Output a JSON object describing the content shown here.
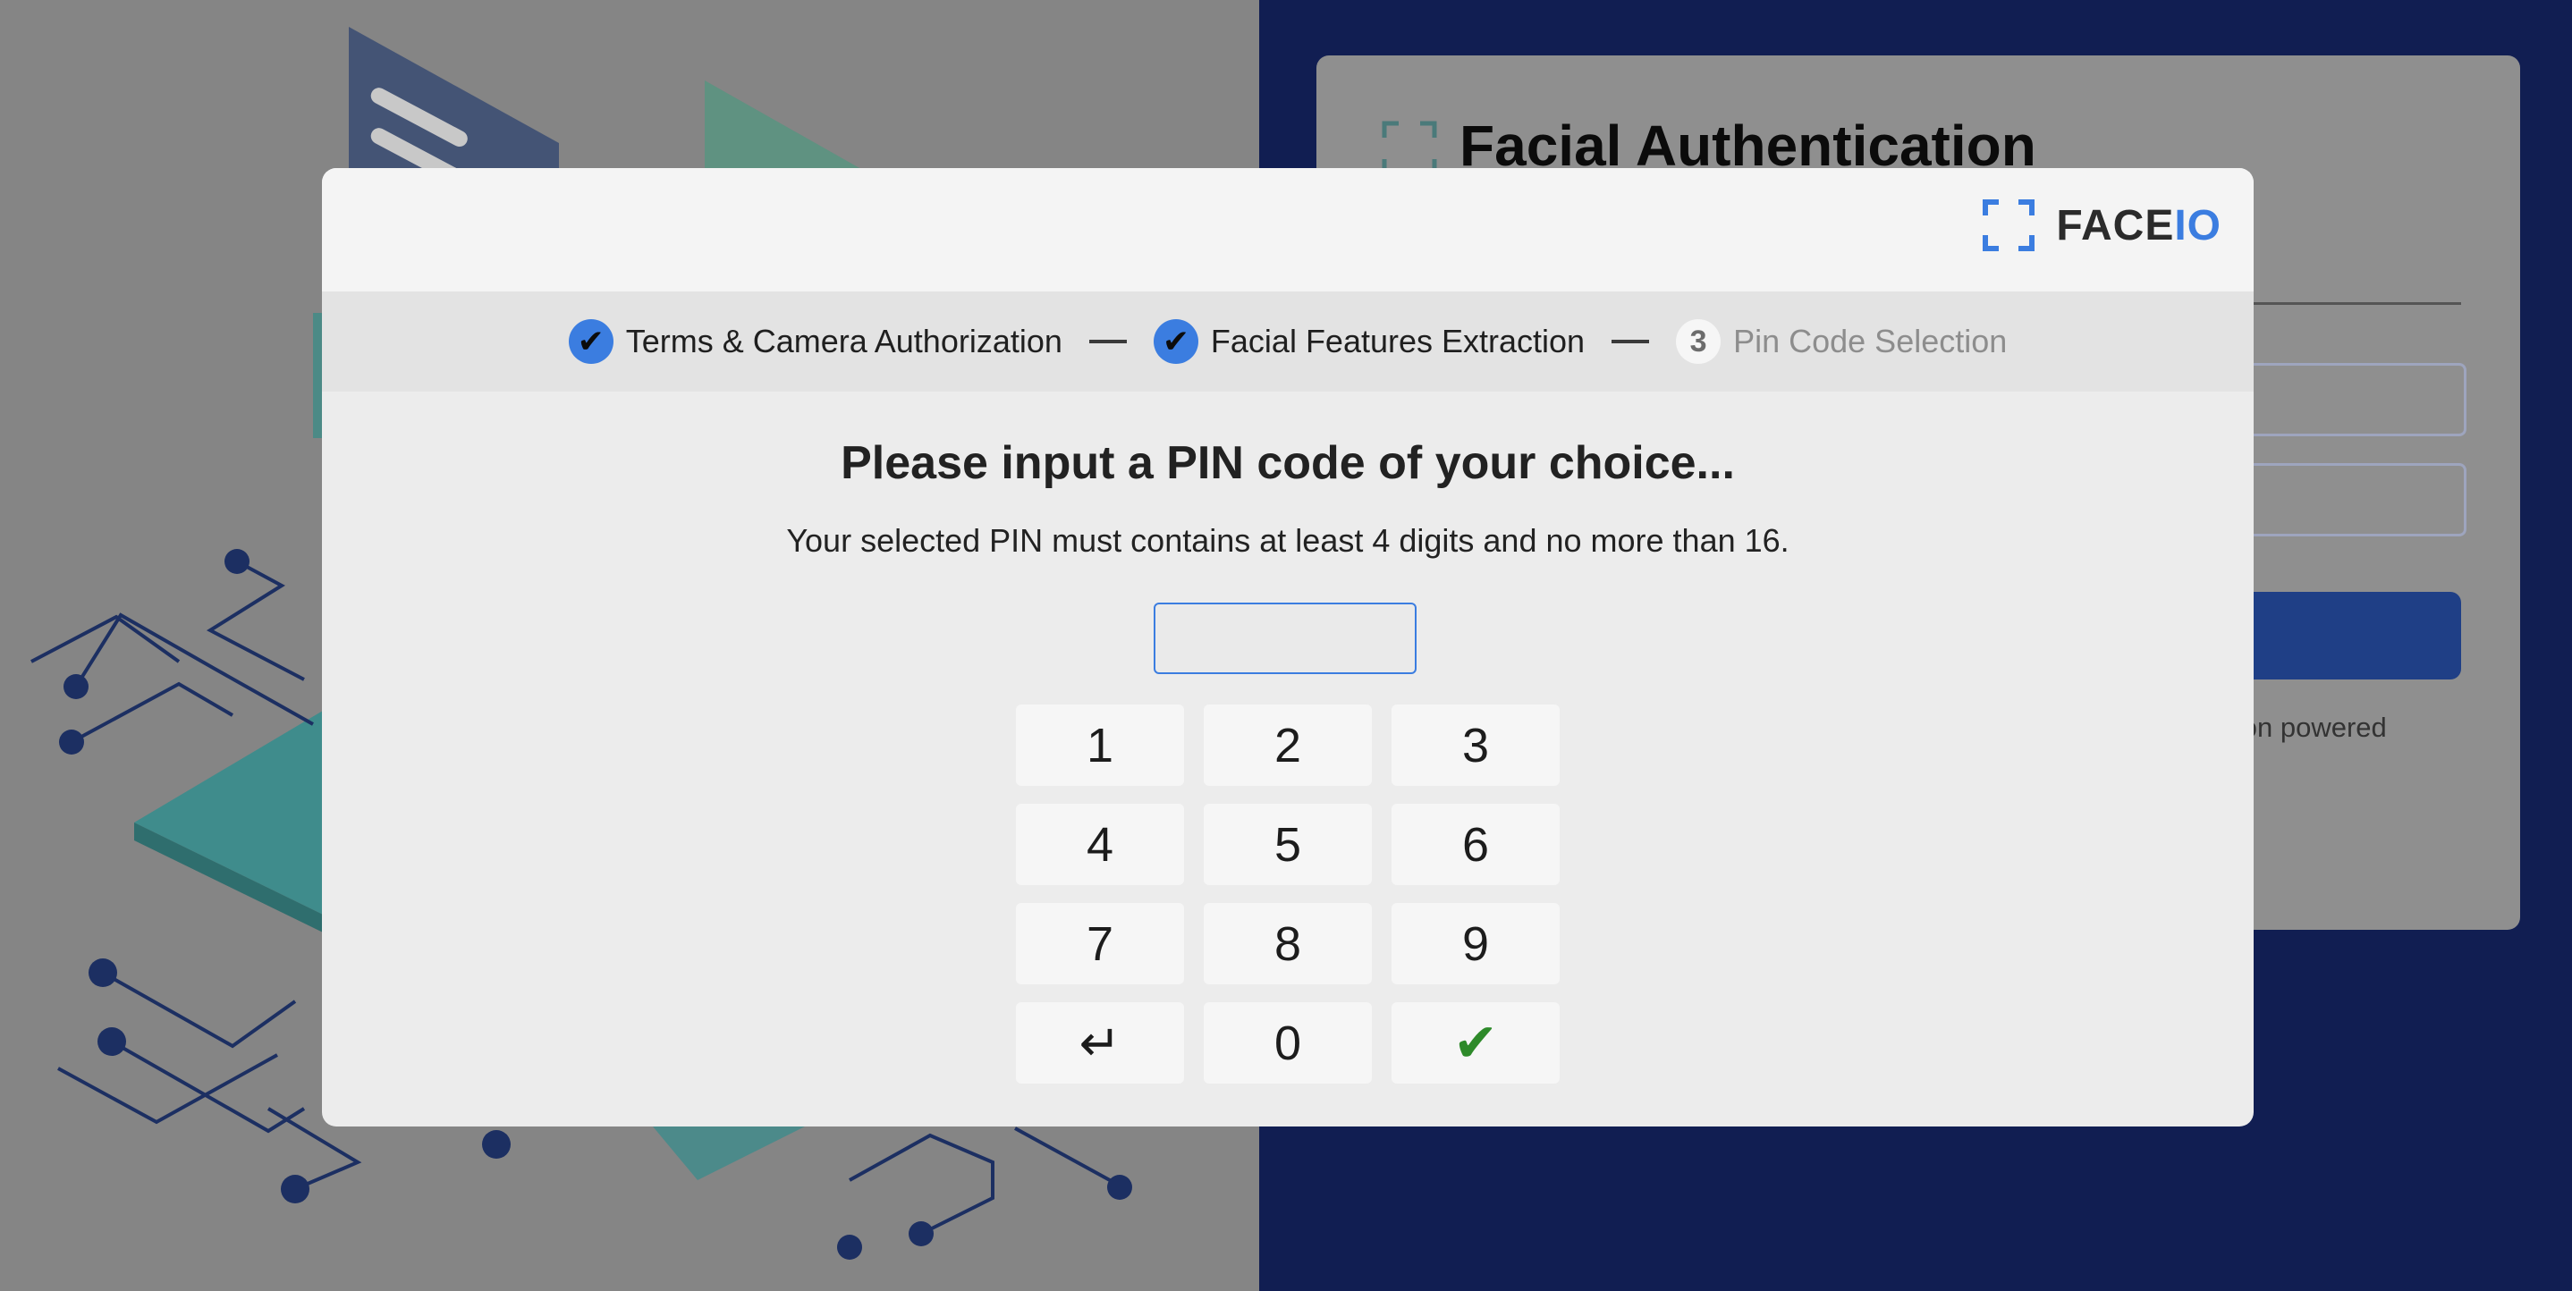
{
  "background": {
    "card_title": "Facial Authentication",
    "footer_note": "ation powered"
  },
  "modal": {
    "brand": {
      "face": "FACE",
      "io": "IO"
    },
    "steps": [
      {
        "label": "Terms & Camera Authorization",
        "status": "done",
        "icon": "✔"
      },
      {
        "label": "Facial Features Extraction",
        "status": "done",
        "icon": "✔"
      },
      {
        "label": "Pin Code Selection",
        "status": "active",
        "number": "3"
      }
    ],
    "title": "Please input a PIN code of your choice...",
    "subtitle": "Your selected PIN must contains at least 4 digits and no more than 16.",
    "pin_input": {
      "value": ""
    },
    "keypad": {
      "keys": [
        "1",
        "2",
        "3",
        "4",
        "5",
        "6",
        "7",
        "8",
        "9"
      ],
      "backspace": "↵",
      "zero": "0",
      "confirm": "✔"
    }
  },
  "colors": {
    "accent": "#3b7de0",
    "confirm": "#2e8a2a",
    "backdrop_right": "#111e52"
  }
}
